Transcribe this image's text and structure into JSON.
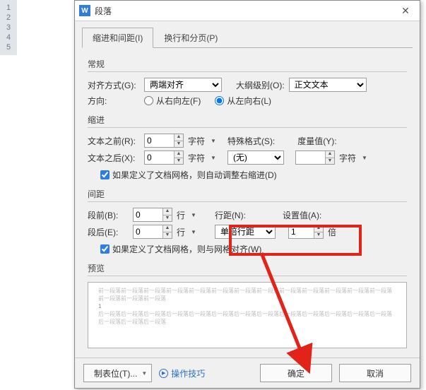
{
  "line_numbers": [
    "1",
    "2",
    "3",
    "4",
    "5"
  ],
  "dialog": {
    "icon_letter": "W",
    "title": "段落",
    "tabs": {
      "indent": "缩进和间距(I)",
      "pagebreak": "换行和分页(P)"
    },
    "general": {
      "header": "常规",
      "align_label": "对齐方式(G):",
      "align_value": "两端对齐",
      "outline_label": "大纲级别(O):",
      "outline_value": "正文文本",
      "direction_label": "方向:",
      "rtl": "从右向左(F)",
      "ltr": "从左向右(L)"
    },
    "indent": {
      "header": "缩进",
      "before_label": "文本之前(R):",
      "before_value": "0",
      "after_label": "文本之后(X):",
      "after_value": "0",
      "unit_char": "字符",
      "special_label": "特殊格式(S):",
      "special_value": "(无)",
      "measure_label": "度量值(Y):",
      "measure_value": "",
      "grid_cb": "如果定义了文档网格，则自动调整右缩进(D)"
    },
    "spacing": {
      "header": "间距",
      "before_label": "段前(B):",
      "before_value": "0",
      "after_label": "段后(E):",
      "after_value": "0",
      "unit_line": "行",
      "line_spacing_label": "行距(N):",
      "line_spacing_value": "单倍行距",
      "setvalue_label": "设置值(A):",
      "setvalue_value": "1",
      "unit_bei": "倍",
      "grid_cb": "如果定义了文档网格，则与网格对齐(W)"
    },
    "preview": {
      "header": "预览",
      "sample_before": "前一段落前一段落前一段落前一段落前一段落前一段落前一段落前一段落前一段落前一段落前一段落前一段落前一段落前一段落前一段落前一段落",
      "sample_num": "1",
      "sample_after": "后一段落后一段落后一段落后一段落后一段落后一段落后一段落后一段落后一段落后一段落后一段落后一段落后一段落后一段落后一段落后一段落"
    },
    "footer": {
      "tabstops": "制表位(T)...",
      "tips": "操作技巧",
      "ok": "确定",
      "cancel": "取消"
    }
  }
}
